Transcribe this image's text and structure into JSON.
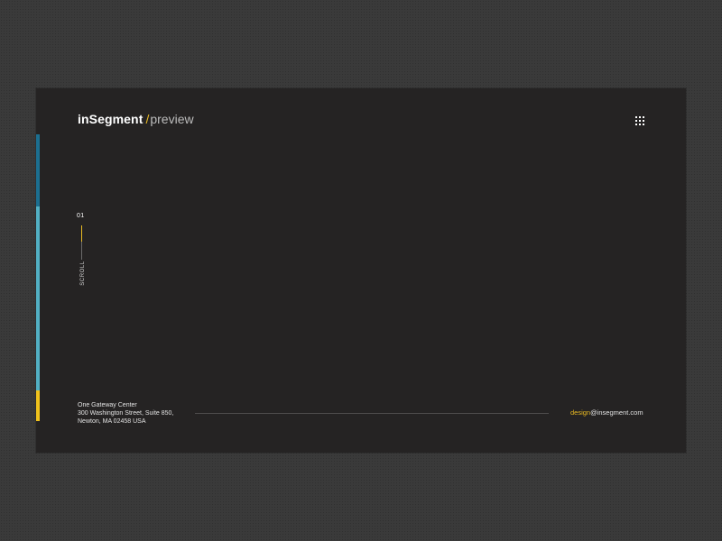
{
  "header": {
    "brand": "inSegment",
    "slash": "/",
    "suffix": "preview",
    "menu_icon": "grid-menu-icon"
  },
  "colors": {
    "page_background": "#3a3a3a",
    "frame_background": "#252323",
    "accent_gold": "#e8b923",
    "bar_dark_blue": "#1c6f90",
    "bar_light_blue": "#52b0c4",
    "bar_yellow": "#f0c21c"
  },
  "scroll_indicator": {
    "page_number": "01",
    "label": "SCROLL"
  },
  "footer": {
    "address_lines": [
      "One Gateway Center",
      "300 Washington Street, Suite 850,",
      "Newton, MA 02458 USA"
    ],
    "email_user": "design",
    "email_domain": "@insegment.com"
  }
}
